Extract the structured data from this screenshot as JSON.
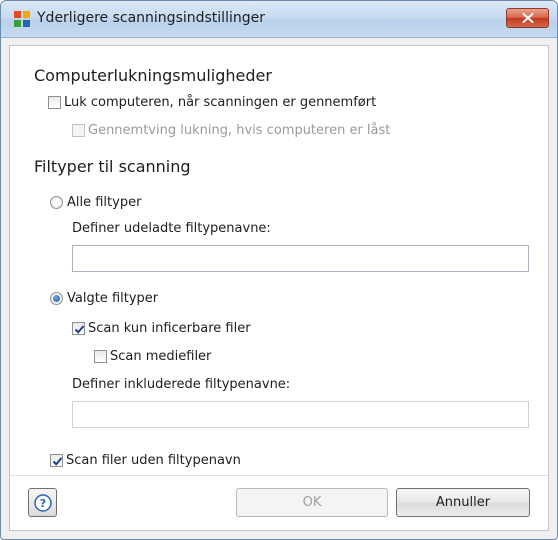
{
  "window": {
    "title": "Yderligere scanningsindstillinger"
  },
  "shutdown": {
    "heading": "Computerlukningsmuligheder",
    "shutdown_after_scan": {
      "label": "Luk computeren, når scanningen er gennemført",
      "checked": false
    },
    "force_shutdown_locked": {
      "label": "Gennemtving lukning, hvis computeren er låst",
      "checked": false,
      "enabled": false
    }
  },
  "filetypes": {
    "heading": "Filtyper til scanning",
    "all_types": {
      "label": "Alle filtyper",
      "selected": false
    },
    "exclude_ext_label": "Definer udeladte filtypenavne:",
    "exclude_ext_value": "",
    "selected_types": {
      "label": "Valgte filtyper",
      "selected": true
    },
    "infectable_only": {
      "label": "Scan kun inficerbare filer",
      "checked": true
    },
    "media_files": {
      "label": "Scan mediefiler",
      "checked": false
    },
    "include_ext_label": "Definer inkluderede filtypenavne:",
    "include_ext_value": "",
    "no_extension": {
      "label": "Scan filer uden filtypenavn",
      "checked": true
    }
  },
  "buttons": {
    "help_symbol": "?",
    "ok": "OK",
    "cancel": "Annuller"
  },
  "colors": {
    "title_bar": "#c7dbf1",
    "close_button": "#c9462b",
    "check_mark": "#1f3d8a",
    "radio_dot": "#1c59a8",
    "help_icon": "#2a63b8"
  }
}
